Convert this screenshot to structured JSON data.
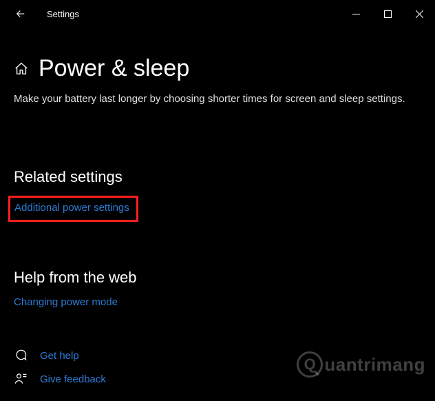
{
  "window": {
    "title": "Settings"
  },
  "page": {
    "title": "Power & sleep",
    "description": "Make your battery last longer by choosing shorter times for screen and sleep settings."
  },
  "related": {
    "heading": "Related settings",
    "link1": "Additional power settings"
  },
  "webhelp": {
    "heading": "Help from the web",
    "link1": "Changing power mode"
  },
  "support": {
    "get_help": "Get help",
    "give_feedback": "Give feedback"
  },
  "watermark": {
    "text": "uantrimang"
  }
}
